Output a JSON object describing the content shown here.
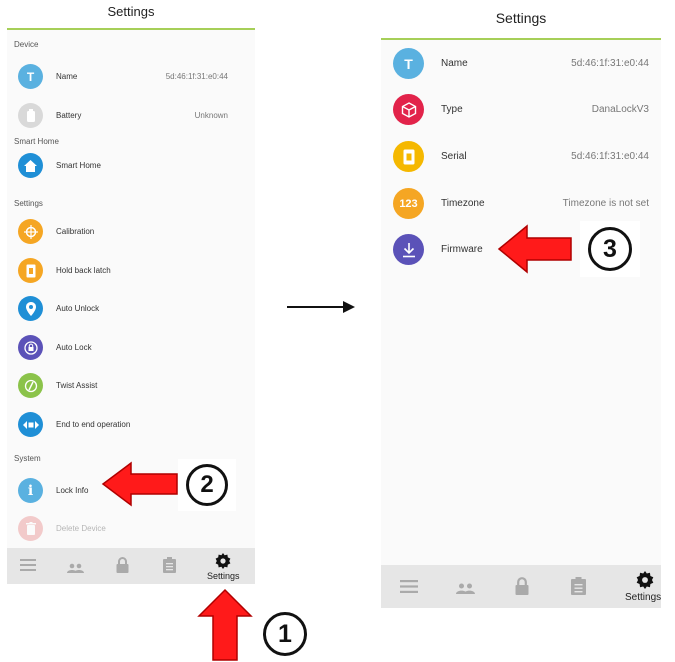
{
  "left_screen": {
    "title": "Settings",
    "sections": {
      "device": "Device",
      "smart_home": "Smart Home",
      "settings": "Settings",
      "system": "System"
    },
    "items": [
      {
        "label": "Name",
        "value": "5d:46:1f:31:e0:44",
        "icon": "letter-t-icon",
        "glyph": "T",
        "color": "#5ab1e0"
      },
      {
        "label": "Battery",
        "value": "Unknown",
        "icon": "battery-icon",
        "color": "#d9d9d9"
      },
      {
        "label": "Smart Home",
        "icon": "home-icon",
        "color": "#1f8fd6"
      },
      {
        "label": "Calibration",
        "icon": "crosshair-icon",
        "color": "#f5a623"
      },
      {
        "label": "Hold back latch",
        "icon": "latch-icon",
        "color": "#f5a623"
      },
      {
        "label": "Auto Unlock",
        "icon": "location-pin-icon",
        "color": "#1f8fd6"
      },
      {
        "label": "Auto Lock",
        "icon": "auto-lock-icon",
        "color": "#5b52b8"
      },
      {
        "label": "Twist Assist",
        "icon": "twist-icon",
        "color": "#8bc34a"
      },
      {
        "label": "End to end operation",
        "icon": "end-to-end-icon",
        "color": "#1f8fd6"
      },
      {
        "label": "Lock Info",
        "icon": "info-icon",
        "glyph": "i",
        "color": "#5ab1e0"
      },
      {
        "label": "Delete Device",
        "icon": "trash-icon",
        "color": "#e57373"
      }
    ],
    "tab_label": "Settings"
  },
  "right_screen": {
    "title": "Settings",
    "items": [
      {
        "label": "Name",
        "value": "5d:46:1f:31:e0:44",
        "icon": "letter-t-icon",
        "glyph": "T",
        "color": "#5ab1e0"
      },
      {
        "label": "Type",
        "value": "DanaLockV3",
        "icon": "cube-icon",
        "color": "#e2234a"
      },
      {
        "label": "Serial",
        "value": "5d:46:1f:31:e0:44",
        "icon": "serial-icon",
        "color": "#f5b800"
      },
      {
        "label": "Timezone",
        "value": "Timezone is not set",
        "icon": "numbers-icon",
        "glyph": "123",
        "color": "#f5a623"
      },
      {
        "label": "Firmware",
        "icon": "download-icon",
        "color": "#5b52b8"
      }
    ],
    "tab_label": "Settings"
  },
  "markers": {
    "one": "1",
    "two": "2",
    "three": "3"
  },
  "colors": {
    "accent_green": "#a6cf58",
    "arrow_red": "#ff1a1a"
  }
}
